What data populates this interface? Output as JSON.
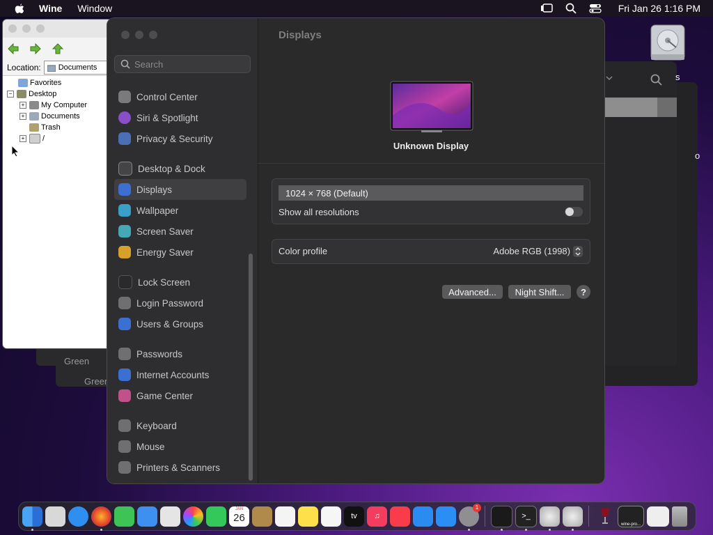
{
  "menubar": {
    "app_name": "Wine",
    "menu_window": "Window",
    "clock": "Fri Jan 26  1:16 PM"
  },
  "wine_explorer": {
    "location_label": "Location:",
    "location_value": "Documents",
    "tree": [
      {
        "label": "Favorites"
      },
      {
        "label": "Desktop"
      },
      {
        "label": "My Computer"
      },
      {
        "label": "Documents"
      },
      {
        "label": "Trash"
      },
      {
        "label": "/"
      }
    ]
  },
  "background": {
    "green_label_1": "Green",
    "green_label_2": "Green",
    "hd_label": "s",
    "right_label": "o"
  },
  "settings": {
    "search_placeholder": "Search",
    "sidebar": [
      {
        "label": "Control Center",
        "color": "#7a7a7c"
      },
      {
        "label": "Siri & Spotlight",
        "color": "#8a4fc7"
      },
      {
        "label": "Privacy & Security",
        "color": "#4a6fb5"
      },
      {
        "label": "Desktop & Dock",
        "color": "#444446"
      },
      {
        "label": "Displays",
        "color": "#3b6fd1"
      },
      {
        "label": "Wallpaper",
        "color": "#3aa0c8"
      },
      {
        "label": "Screen Saver",
        "color": "#46a7b5"
      },
      {
        "label": "Energy Saver",
        "color": "#d6a12a"
      },
      {
        "label": "Lock Screen",
        "color": "#2a2a2c"
      },
      {
        "label": "Login Password",
        "color": "#6f6f71"
      },
      {
        "label": "Users & Groups",
        "color": "#3b6fd1"
      },
      {
        "label": "Passwords",
        "color": "#6f6f71"
      },
      {
        "label": "Internet Accounts",
        "color": "#3b6fd1"
      },
      {
        "label": "Game Center",
        "color": "#c2508a"
      },
      {
        "label": "Keyboard",
        "color": "#6f6f71"
      },
      {
        "label": "Mouse",
        "color": "#6f6f71"
      },
      {
        "label": "Printers & Scanners",
        "color": "#6f6f71"
      }
    ],
    "content": {
      "title": "Displays",
      "display_name": "Unknown Display",
      "resolution": "1024 × 768 (Default)",
      "show_all_resolutions": "Show all resolutions",
      "color_profile_label": "Color profile",
      "color_profile_value": "Adobe RGB (1998)",
      "advanced_button": "Advanced...",
      "night_shift_button": "Night Shift...",
      "help_button": "?"
    }
  },
  "dock": {
    "calendar_month": "JAN",
    "calendar_day": "26",
    "settings_badge": "1",
    "tv_label": "tv",
    "terminal_prompt": ">_",
    "wine_label": "wine-pro..."
  }
}
